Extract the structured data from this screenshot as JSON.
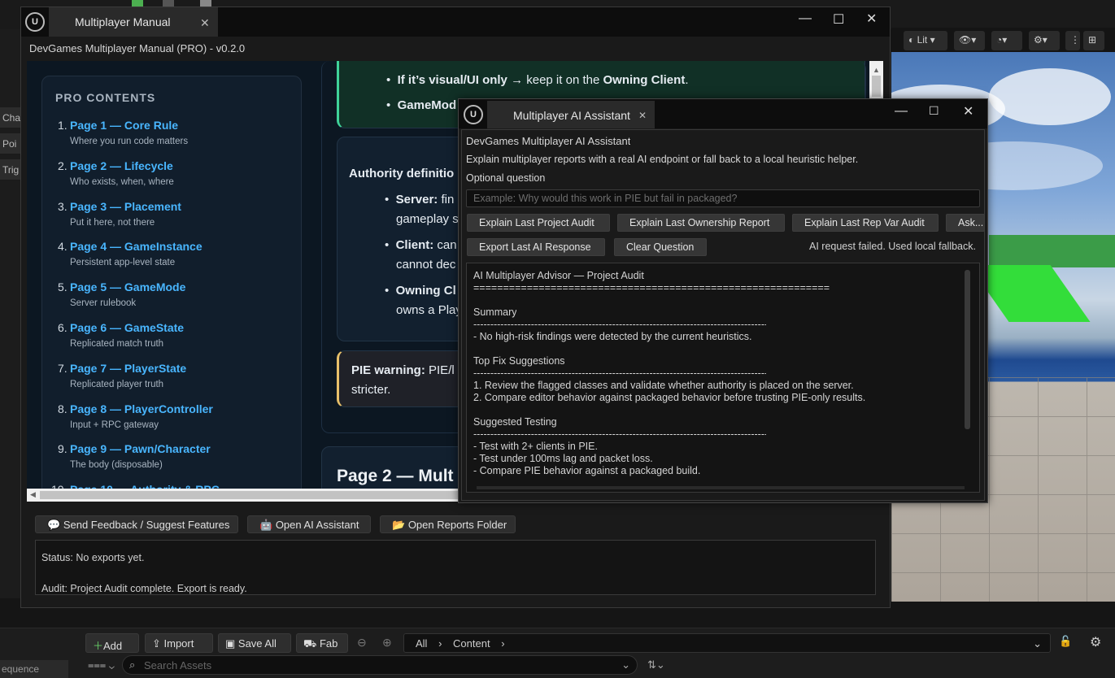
{
  "editor": {
    "left_tabs": [
      "Cha",
      "Poi",
      "Trig"
    ],
    "viewport_buttons": {
      "lit": "Lit"
    },
    "content_browser": {
      "add": "Add",
      "import": "Import",
      "save_all": "Save All",
      "fab": "Fab",
      "path": [
        "All",
        "Content"
      ],
      "search_placeholder": "Search Assets",
      "sequence": "equence"
    }
  },
  "manual": {
    "tab_title": "Multiplayer Manual",
    "subtitle": "DevGames Multiplayer Manual (PRO) - v0.2.0",
    "toc_heading": "PRO CONTENTS",
    "toc": [
      {
        "num": "1.",
        "title": "Page 1 — Core Rule",
        "sub": "Where you run code matters"
      },
      {
        "num": "2.",
        "title": "Page 2 — Lifecycle",
        "sub": "Who exists, when, where"
      },
      {
        "num": "3.",
        "title": "Page 3 — Placement",
        "sub": "Put it here, not there"
      },
      {
        "num": "4.",
        "title": "Page 4 — GameInstance",
        "sub": "Persistent app-level state"
      },
      {
        "num": "5.",
        "title": "Page 5 — GameMode",
        "sub": "Server rulebook"
      },
      {
        "num": "6.",
        "title": "Page 6 — GameState",
        "sub": "Replicated match truth"
      },
      {
        "num": "7.",
        "title": "Page 7 — PlayerState",
        "sub": "Replicated player truth"
      },
      {
        "num": "8.",
        "title": "Page 8 — PlayerController",
        "sub": "Input + RPC gateway"
      },
      {
        "num": "9.",
        "title": "Page 9 — Pawn/Character",
        "sub": "The body (disposable)"
      },
      {
        "num": "10.",
        "title": "Page 10 — Authority & RPC",
        "sub": ""
      }
    ],
    "card1": {
      "bullet1_bold": "If it’s visual/UI only",
      "bullet1_rest": " → keep it on the ",
      "bullet1_bold2": "Owning Client",
      "bullet1_end": ".",
      "bullet2": "GameMod"
    },
    "card2": {
      "heading": "Authority definitio",
      "items": [
        {
          "bold": "Server:",
          "rest": " fin",
          "line2": "gameplay s"
        },
        {
          "bold": "Client:",
          "rest": " can",
          "line2": "cannot dec"
        },
        {
          "bold": "Owning Cl",
          "rest": "",
          "line2": "owns a Play"
        }
      ]
    },
    "warning": {
      "bold": "PIE warning:",
      "rest": " PIE/l",
      "line2": "stricter."
    },
    "page2_heading": "Page 2 — Mult",
    "buttons": {
      "feedback": "Send Feedback / Suggest Features",
      "ai": "Open AI Assistant",
      "reports": "Open Reports Folder"
    },
    "status": {
      "line1": "Status: No exports yet.",
      "line2": "Audit: Project Audit complete. Export is ready."
    }
  },
  "ai": {
    "tab_title": "Multiplayer AI Assistant",
    "title": "DevGames Multiplayer AI Assistant",
    "description": "Explain multiplayer reports with a real AI endpoint or fall back to a local heuristic helper.",
    "question_label": "Optional question",
    "question_placeholder": "Example: Why would this work in PIE but fail in packaged?",
    "buttons": {
      "project_audit": "Explain Last Project Audit",
      "ownership": "Explain Last Ownership Report",
      "rep_var": "Explain Last Rep Var Audit",
      "ask": "Ask...",
      "export": "Export Last AI Response",
      "clear": "Clear Question"
    },
    "status": "AI request failed. Used local fallback.",
    "output": {
      "heading": "AI Multiplayer Advisor — Project Audit",
      "rule_long": "============================================================",
      "rule_short": "----------------------------------------------------------------------------------------",
      "summary_h": "Summary",
      "summary_1": "- No high-risk findings were detected by the current heuristics.",
      "fix_h": "Top Fix Suggestions",
      "fix_1": "1. Review the flagged classes and validate whether authority is placed on the server.",
      "fix_2": "2. Compare editor behavior against packaged behavior before trusting PIE-only results.",
      "test_h": "Suggested Testing",
      "test_1": "- Test with 2+ clients in PIE.",
      "test_2": "- Test under 100ms lag and packet loss.",
      "test_3": "- Compare PIE behavior against a packaged build."
    }
  },
  "colors": {
    "link": "#49b6ff",
    "card_green_border": "#3fd29a",
    "warning_border": "#e8c06a",
    "vp_green": "#33dd3a"
  }
}
